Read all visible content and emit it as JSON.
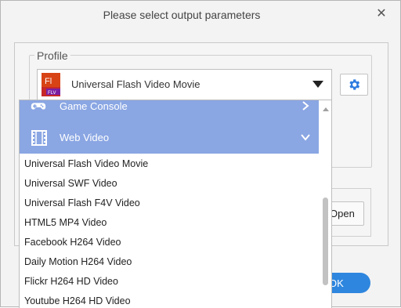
{
  "dialog": {
    "title": "Please select output parameters",
    "close_icon": "close-icon"
  },
  "profile": {
    "legend": "Profile",
    "selected": "Universal Flash Video Movie",
    "selected_icon": "flv-file-icon",
    "settings_icon": "gear-icon"
  },
  "dropdown": {
    "categories": [
      {
        "label": "Game Console",
        "icon": "gamepad-icon",
        "expanded": false
      },
      {
        "label": "Web Video",
        "icon": "film-icon",
        "expanded": true
      }
    ],
    "items": [
      "Universal Flash Video Movie",
      "Universal SWF Video",
      "Universal Flash F4V Video",
      "HTML5 MP4 Video",
      "Facebook H264 Video",
      "Daily Motion H264 Video",
      "Flickr H264 HD Video",
      "Youtube H264 HD Video"
    ]
  },
  "buttons": {
    "open": "Open",
    "ok": "OK"
  },
  "colors": {
    "category_bg": "#8aa6e3",
    "accent": "#2e86de",
    "gear": "#2e7be0"
  }
}
